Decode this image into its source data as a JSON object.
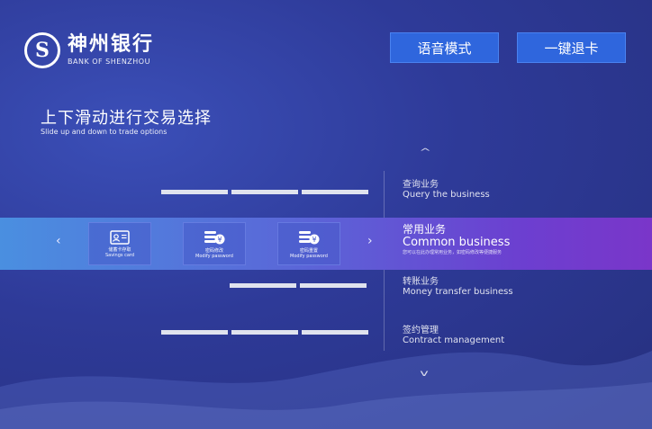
{
  "header": {
    "logo_mark": "S",
    "bank_name_cn": "神州银行",
    "bank_name_en": "BANK OF SHENZHOU",
    "voice_mode_label": "语音模式",
    "eject_card_label": "一键退卡"
  },
  "hint": {
    "title": "上下滑动进行交易选择",
    "subtitle": "Slide up and down to trade options"
  },
  "categories": [
    {
      "cn": "查询业务",
      "en": "Query the business"
    },
    {
      "cn": "常用业务",
      "en": "Common business",
      "desc": "您可以在此办理常用业务，如密码修改等便捷服务"
    },
    {
      "cn": "转账业务",
      "en": "Money transfer business"
    },
    {
      "cn": "签约管理",
      "en": "Contract management"
    }
  ],
  "common_items": [
    {
      "cn": "储蓄卡存取",
      "en": "Savings card",
      "icon": "card-icon"
    },
    {
      "cn": "密码修改",
      "en": "Modify password",
      "icon": "coin-stack-icon"
    },
    {
      "cn": "密码重置",
      "en": "Modify password",
      "icon": "coin-stack-icon"
    }
  ],
  "nav": {
    "left": "‹",
    "right": "›",
    "up": "^",
    "down": "v"
  },
  "colors": {
    "button": "#2f66dd",
    "band_start": "#4a8fe0",
    "band_end": "#7a36c9",
    "background": "#2e3a98"
  }
}
